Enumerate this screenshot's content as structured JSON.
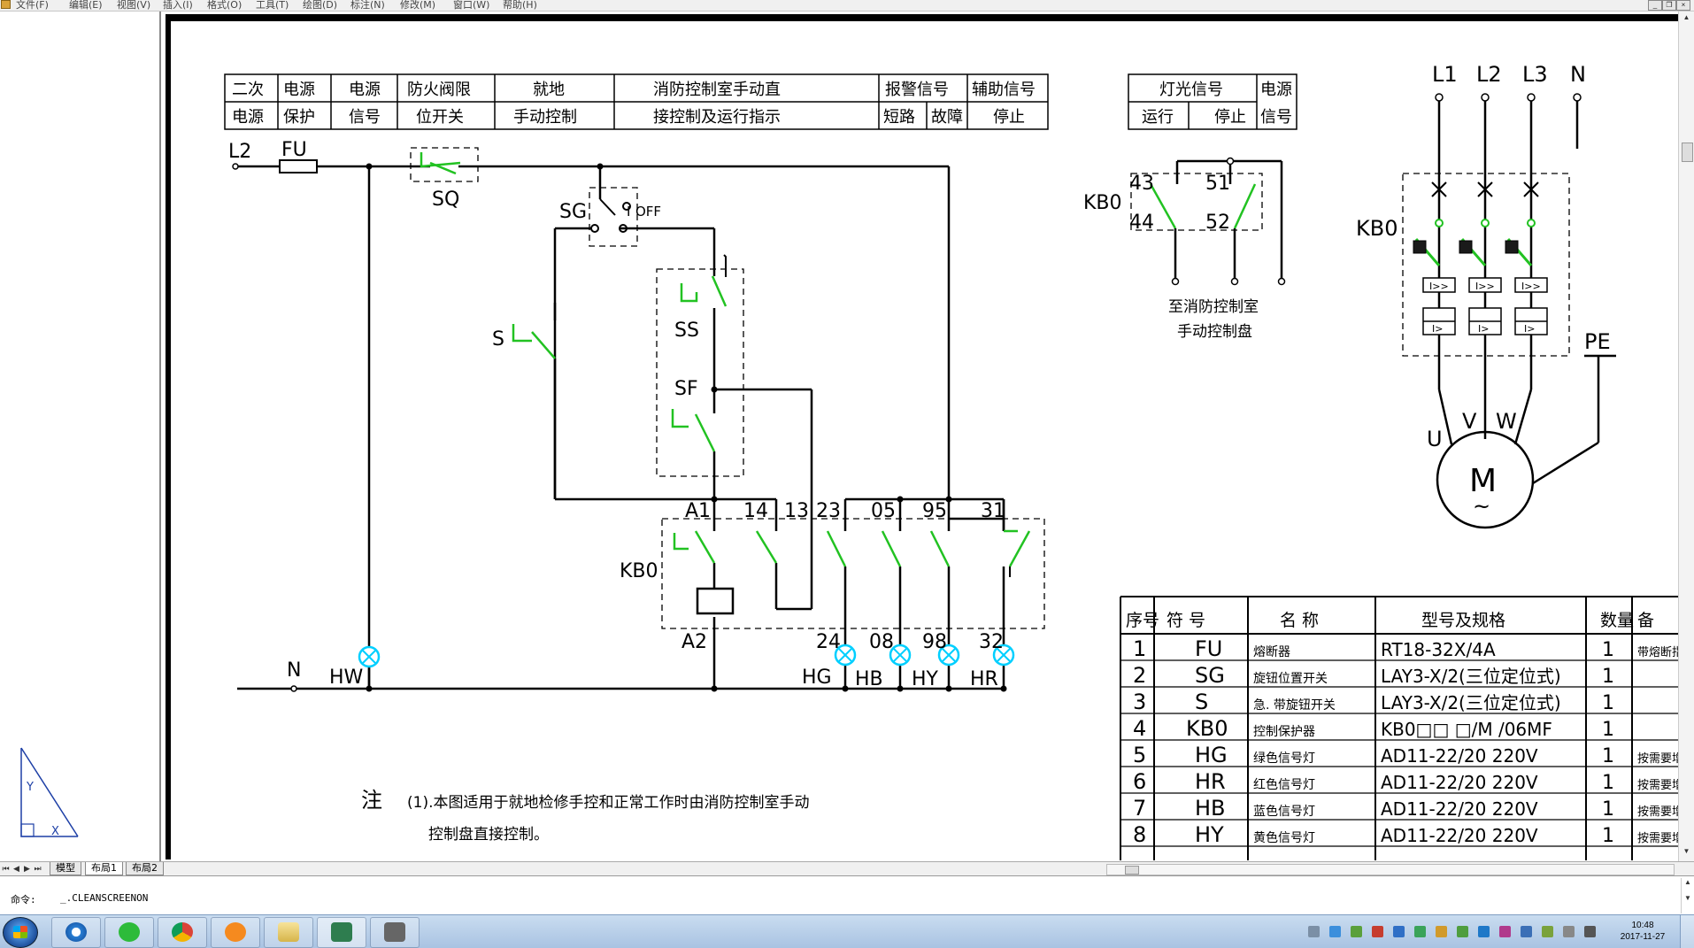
{
  "menubar": {
    "items": [
      "文件(F)",
      "编辑(E)",
      "视图(V)",
      "插入(I)",
      "格式(O)",
      "工具(T)",
      "绘图(D)",
      "标注(N)",
      "修改(M)",
      "窗口(W)",
      "帮助(H)"
    ]
  },
  "drawing": {
    "table_headers": {
      "h1": [
        "二次",
        "电源"
      ],
      "h2": [
        "电源",
        "保护"
      ],
      "h3": [
        "电源",
        "信号"
      ],
      "h4": [
        "防火阀限",
        "位开关"
      ],
      "h5": [
        "就地",
        "手动控制"
      ],
      "h6": [
        "消防控制室手动直",
        "接控制及运行指示"
      ],
      "h7": "报警信号",
      "h7a": "短路",
      "h7b": "故障",
      "h8": "辅助信号",
      "h8a": "停止"
    },
    "signal_table": {
      "t1": "灯光信号",
      "t1a": "运行",
      "t1b": "停止",
      "t2": [
        "电源",
        "信号"
      ]
    },
    "labels": {
      "L2": "L2",
      "FU": "FU",
      "SQ": "SQ",
      "SG": "SG",
      "OFF": "OFF",
      "I": "I",
      "S": "S",
      "SS": "SS",
      "SF": "SF",
      "KB0": "KB0",
      "A1": "A1",
      "A2": "A2",
      "n14": "14",
      "n13": "13",
      "n23": "23",
      "n05": "05",
      "n95": "95",
      "n31": "31",
      "n24": "24",
      "n08": "08",
      "n98": "98",
      "n32": "32",
      "N": "N",
      "HW": "HW",
      "HG": "HG",
      "HB": "HB",
      "HY": "HY",
      "HR": "HR",
      "n43": "43",
      "n44": "44",
      "n51": "51",
      "n52": "52",
      "to_fire_1": "至消防控制室",
      "to_fire_2": "手动控制盘",
      "P_L1": "L1",
      "P_L2": "L2",
      "P_L3": "L3",
      "P_N": "N",
      "PE": "PE",
      "U": "U",
      "V": "V",
      "W": "W",
      "M": "M",
      "ac": "~",
      "trip": "I>>",
      "trip2": "I>"
    },
    "note_mark": "注",
    "note_line1": "(1).本图适用于就地检修手控和正常工作时由消防控制室手动",
    "note_line2": "控制盘直接控制。",
    "bom": {
      "headers": [
        "序号",
        "符 号",
        "名 称",
        "型号及规格",
        "数量",
        "备"
      ],
      "rows": [
        [
          "1",
          "FU",
          "熔断器",
          "RT18-32X/4A",
          "1",
          "带熔断指示"
        ],
        [
          "2",
          "SG",
          "旋钮位置开关",
          "LAY3-X/2(三位定位式)",
          "1",
          ""
        ],
        [
          "3",
          "S",
          "急. 带旋钮开关",
          "LAY3-X/2(三位定位式)",
          "1",
          ""
        ],
        [
          "4",
          "KB0",
          "控制保护器",
          "KB0□□ □/M /06MF",
          "1",
          ""
        ],
        [
          "5",
          "HG",
          "绿色信号灯",
          "AD11-22/20  220V",
          "1",
          "按需要增"
        ],
        [
          "6",
          "HR",
          "红色信号灯",
          "AD11-22/20  220V",
          "1",
          "按需要增"
        ],
        [
          "7",
          "HB",
          "蓝色信号灯",
          "AD11-22/20  220V",
          "1",
          "按需要增"
        ],
        [
          "8",
          "HY",
          "黄色信号灯",
          "AD11-22/20  220V",
          "1",
          "按需要增"
        ]
      ]
    }
  },
  "tabs": [
    "模型",
    "布局1",
    "布局2"
  ],
  "command": {
    "prompt": "命令:",
    "value": "_.CLEANSCREENON"
  },
  "clock": {
    "time": "10:48",
    "date": "2017-11-27"
  },
  "ucs": {
    "y": "Y",
    "x": "X"
  },
  "colors": {
    "switch_green": "#22c222",
    "lamp_cyan": "#00cfff",
    "line": "#000000"
  }
}
